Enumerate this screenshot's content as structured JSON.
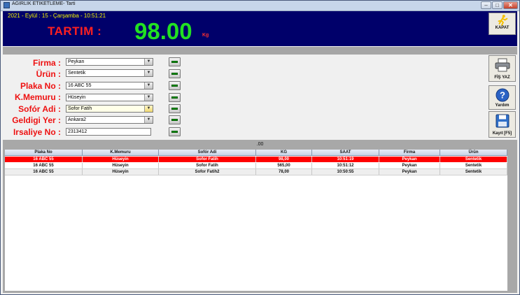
{
  "window": {
    "title": "AGIRLIK ETIKETLEME- Tarti"
  },
  "header": {
    "datetime": "2021 - Eylül : 15 - Çarşamba - 10:51:21",
    "tartim_label": "TARTIM :",
    "tartim_value": "98.00",
    "unit": "Kg",
    "kapat_label": "KAPAT"
  },
  "form": {
    "firma": {
      "label": "Firma :",
      "value": "Peykan"
    },
    "urun": {
      "label": "Ürün :",
      "value": "Sentetik"
    },
    "plaka": {
      "label": "Plaka No :",
      "value": "16 ABC 55"
    },
    "memur": {
      "label": "K.Memuru :",
      "value": "Hüseyin"
    },
    "sofor": {
      "label": "Sofór Adi :",
      "value": "Sofor Fatih"
    },
    "geldigi": {
      "label": "Geldigi Yer :",
      "value": "Ankara2"
    },
    "irsaliye": {
      "label": "Irsaliye No :",
      "value": "2313412"
    }
  },
  "side": {
    "fis_yaz": "FİŞ YAZ",
    "yardim": "Yardım",
    "kayit": "Kayıt [F5]"
  },
  "grid": {
    "top_label": ".00",
    "columns": [
      "Plaka No",
      "K.Memuru",
      "Sofór Adi",
      "KG",
      "SAAT",
      "Firma",
      "Ürün"
    ],
    "rows": [
      [
        "16 ABC 55",
        "Hüseyin",
        "Sofor Fatih",
        "98,00",
        "10:51:19",
        "Peykan",
        "Sentetik"
      ],
      [
        "16 ABC 55",
        "Hüseyin",
        "Sofor Fatih",
        "565,00",
        "10:51:12",
        "Peykan",
        "Sentetik"
      ],
      [
        "16 ABC 55",
        "Hüseyin",
        "Sofor Fatih2",
        "78,00",
        "10:50:55",
        "Peykan",
        "Sentetik"
      ]
    ],
    "selected_color": "#ff0000"
  },
  "colors": {
    "header_bg": "#00006a",
    "label_red": "#ee1111",
    "weight_green": "#22e022"
  }
}
